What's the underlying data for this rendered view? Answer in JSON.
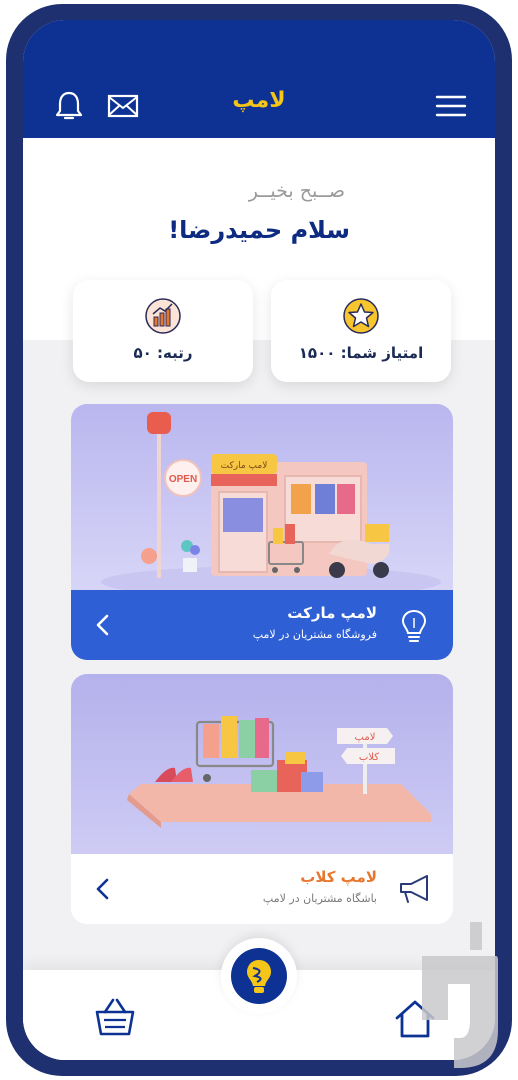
{
  "header": {
    "title": "لامپ",
    "icons": [
      "bell-icon",
      "mail-icon",
      "menu-icon"
    ]
  },
  "greeting": {
    "line1": "صــبح بخیــر",
    "line2": "سلام حمیدرضا!"
  },
  "stats": {
    "score_label": "امتیاز شما: ۱۵۰۰",
    "rank_label": "رتبه: ۵۰"
  },
  "cards": [
    {
      "title": "لامپ مارکت",
      "subtitle": "فروشگاه مشتریان در لامپ",
      "shop_sign": "لامپ مارکت",
      "open_sign": "OPEN"
    },
    {
      "title": "لامپ کلاب",
      "subtitle": "باشگاه مشتریان در لامپ",
      "sign_top": "لامپ",
      "sign_bottom": "کلاب"
    }
  ],
  "nav": {
    "items": [
      "basket-icon",
      "lamp-icon",
      "home-icon"
    ]
  },
  "colors": {
    "brand_blue": "#0d3293",
    "accent_yellow": "#f5c518",
    "card_orange": "#e8772e",
    "frame": "#1e3070"
  }
}
